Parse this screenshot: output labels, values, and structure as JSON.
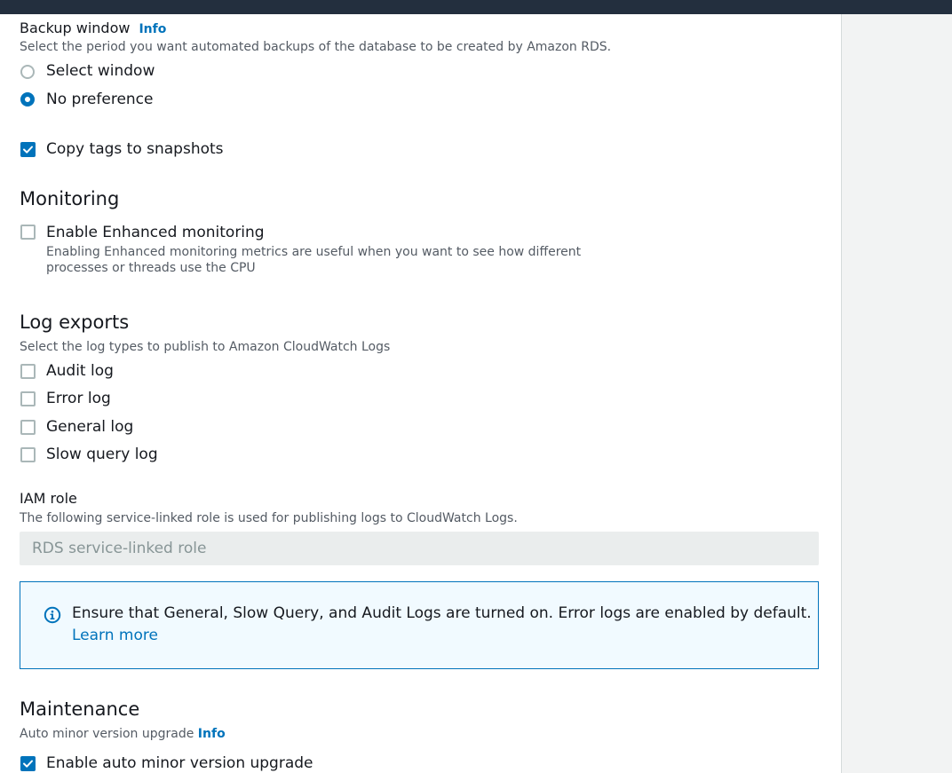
{
  "backup_window": {
    "label": "Backup window",
    "info_link": "Info",
    "description": "Select the period you want automated backups of the database to be created by Amazon RDS.",
    "options": [
      {
        "label": "Select window",
        "selected": false
      },
      {
        "label": "No preference",
        "selected": true
      }
    ]
  },
  "copy_tags": {
    "label": "Copy tags to snapshots",
    "checked": true
  },
  "monitoring": {
    "title": "Monitoring",
    "enhanced": {
      "label": "Enable Enhanced monitoring",
      "checked": false,
      "description_line1": "Enabling Enhanced monitoring metrics are useful when you want to see how different",
      "description_line2": "processes or threads use the CPU"
    }
  },
  "log_exports": {
    "title": "Log exports",
    "description": "Select the log types to publish to Amazon CloudWatch Logs",
    "items": [
      {
        "label": "Audit log",
        "checked": false
      },
      {
        "label": "Error log",
        "checked": false
      },
      {
        "label": "General log",
        "checked": false
      },
      {
        "label": "Slow query log",
        "checked": false
      }
    ]
  },
  "iam_role": {
    "label": "IAM role",
    "description": "The following service-linked role is used for publishing logs to CloudWatch Logs.",
    "value": "RDS service-linked role"
  },
  "alert": {
    "icon": "info-circle-icon",
    "message": "Ensure that General, Slow Query, and Audit Logs are turned on. Error logs are enabled by default.",
    "link": "Learn more"
  },
  "maintenance": {
    "title": "Maintenance",
    "auto_minor_label": "Auto minor version upgrade",
    "info_link": "Info",
    "enable_label": "Enable auto minor version upgrade",
    "enable_checked": true
  },
  "colors": {
    "accent": "#0073bb",
    "topbar": "#232f3e",
    "alert_bg": "#f1faff",
    "sidebar_bg": "#f2f3f3"
  }
}
